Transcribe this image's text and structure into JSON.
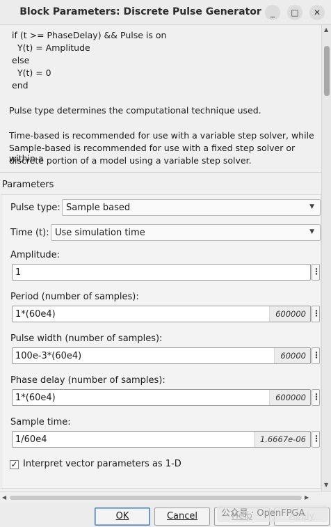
{
  "window": {
    "title": "Block Parameters: Discrete Pulse Generator",
    "minimize": "_",
    "maximize": "□",
    "close": "✕"
  },
  "description": {
    "code_lines": [
      "if (t >= PhaseDelay) && Pulse is on",
      "  Y(t) = Amplitude",
      "else",
      "  Y(t) = 0",
      "end"
    ],
    "paragraph1": "Pulse type determines the computational technique used.",
    "paragraph2_lines": [
      "Time-based is recommended for use with a variable step solver, while",
      "Sample-based is recommended for use with a fixed step solver or within a",
      "discrete portion of a model using a variable step solver."
    ]
  },
  "params": {
    "section_title": "Parameters",
    "pulse_type": {
      "label": "Pulse type:",
      "value": "Sample based"
    },
    "time": {
      "label": "Time (t):",
      "value": "Use simulation time"
    },
    "amplitude": {
      "label": "Amplitude:",
      "value": "1",
      "hint": ""
    },
    "period": {
      "label": "Period (number of samples):",
      "value": "1*(60e4)",
      "hint": "600000"
    },
    "pulse_width": {
      "label": "Pulse width (number of samples):",
      "value": "100e-3*(60e4)",
      "hint": "60000"
    },
    "phase_delay": {
      "label": "Phase delay (number of samples):",
      "value": "1*(60e4)",
      "hint": "600000"
    },
    "sample_time": {
      "label": "Sample time:",
      "value": "1/60e4",
      "hint": "1.6667e-06"
    },
    "interpret_vector": {
      "label": "Interpret vector parameters as 1-D",
      "checked": true,
      "mark": "✓"
    },
    "dots": "⋮"
  },
  "buttons": {
    "ok": "OK",
    "cancel": "Cancel",
    "help": "Help",
    "apply": "Apply"
  },
  "watermark": "公众号 · OpenFPGA"
}
